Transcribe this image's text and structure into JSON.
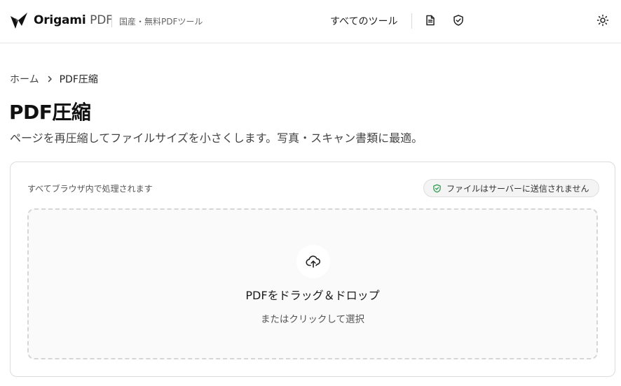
{
  "header": {
    "brand_name": "Origami",
    "brand_suffix": "PDF",
    "tagline": "国産・無料PDFツール",
    "nav_all_tools": "すべてのツール",
    "icons": [
      "logo-icon",
      "document-icon",
      "shield-check-icon",
      "sun-icon"
    ]
  },
  "breadcrumb": {
    "home": "ホーム",
    "current": "PDF圧縮"
  },
  "page": {
    "title": "PDF圧縮",
    "description": "ページを再圧縮してファイルサイズを小さくします。写真・スキャン書類に最適。"
  },
  "card": {
    "note": "すべてブラウザ内で処理されます",
    "privacy_badge": "ファイルはサーバーに送信されません"
  },
  "dropzone": {
    "title": "PDFをドラッグ＆ドロップ",
    "subtitle": "またはクリックして選択"
  },
  "colors": {
    "accent_green": "#2e9d4f",
    "text_primary": "#111111",
    "border": "#dcdcdc"
  }
}
